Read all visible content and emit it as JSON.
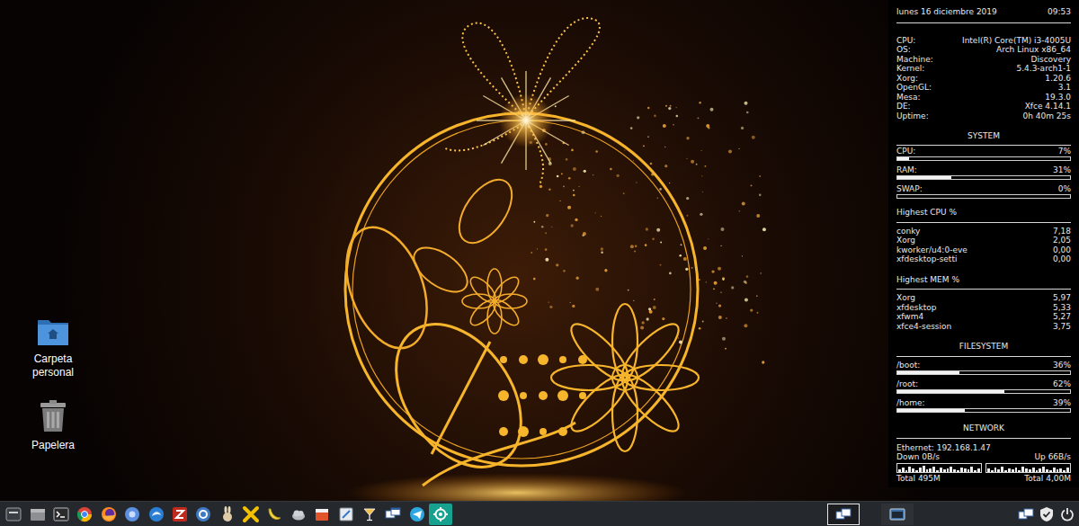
{
  "desktop": {
    "icons": [
      {
        "label": "Carpeta personal"
      },
      {
        "label": "Papelera"
      }
    ]
  },
  "conky": {
    "date": "lunes 16 diciembre 2019",
    "time": "09:53",
    "info": [
      {
        "key": "CPU:",
        "value": "Intel(R) Core(TM) i3-4005U"
      },
      {
        "key": "OS:",
        "value": "Arch Linux x86_64"
      },
      {
        "key": "Machine:",
        "value": "Discovery"
      },
      {
        "key": "Kernel:",
        "value": "5.4.3-arch1-1"
      },
      {
        "key": "Xorg:",
        "value": "1.20.6"
      },
      {
        "key": "OpenGL:",
        "value": "3.1"
      },
      {
        "key": "Mesa:",
        "value": "19.3.0"
      },
      {
        "key": "DE:",
        "value": "Xfce 4.14.1"
      },
      {
        "key": "Uptime:",
        "value": "0h 40m 25s"
      }
    ],
    "system": {
      "title": "SYSTEM",
      "meters": [
        {
          "label": "CPU:",
          "reading": "7%",
          "level": 0.07
        },
        {
          "label": "RAM:",
          "reading": "31%",
          "level": 0.31
        },
        {
          "label": "SWAP:",
          "reading": "0%",
          "level": 0
        }
      ]
    },
    "top_cpu": {
      "title": "Highest CPU %",
      "rows": [
        {
          "name": "conky",
          "value": "7,18"
        },
        {
          "name": "Xorg",
          "value": "2,05"
        },
        {
          "name": "kworker/u4:0-eve",
          "value": "0,00"
        },
        {
          "name": "xfdesktop-setti",
          "value": "0,00"
        }
      ]
    },
    "top_mem": {
      "title": "Highest MEM %",
      "rows": [
        {
          "name": "Xorg",
          "value": "5,97"
        },
        {
          "name": "xfdesktop",
          "value": "5,33"
        },
        {
          "name": "xfwm4",
          "value": "5,27"
        },
        {
          "name": "xfce4-session",
          "value": "3,75"
        }
      ]
    },
    "filesystem": {
      "title": "FILESYSTEM",
      "meters": [
        {
          "label": "/boot:",
          "reading": "36%",
          "level": 0.36
        },
        {
          "label": "/root:",
          "reading": "62%",
          "level": 0.62
        },
        {
          "label": "/home:",
          "reading": "39%",
          "level": 0.39
        }
      ]
    },
    "network": {
      "title": "NETWORK",
      "address": "Ethernet: 192.168.1.47",
      "down": "Down 0B/s",
      "up": "Up 66B/s",
      "down_graph": [
        0.3,
        0.5,
        0.2,
        0.6,
        0.4,
        0.2,
        0.5,
        0.7,
        0.3,
        0.4,
        0.6,
        0.2,
        0.5,
        0.3,
        0.4,
        0.6,
        0.3,
        0.2,
        0.5,
        0.4,
        0.3,
        0.6,
        0.2,
        0.4
      ],
      "up_graph": [
        0.4,
        0.2,
        0.5,
        0.3,
        0.6,
        0.2,
        0.4,
        0.3,
        0.5,
        0.2,
        0.6,
        0.4,
        0.3,
        0.5,
        0.2,
        0.4,
        0.6,
        0.3,
        0.2,
        0.5,
        0.3,
        0.4,
        0.2,
        0.5
      ],
      "total_down": "Total 495M",
      "total_up": "Total 4,00M"
    }
  },
  "taskbar": {
    "launchers": [
      {
        "selected": false
      },
      {
        "selected": false
      },
      {
        "selected": false
      },
      {
        "selected": false
      },
      {
        "selected": false
      },
      {
        "selected": false
      },
      {
        "selected": false
      },
      {
        "selected": false
      },
      {
        "selected": false
      },
      {
        "selected": false
      },
      {
        "selected": false
      },
      {
        "selected": false
      },
      {
        "selected": false
      },
      {
        "selected": false
      },
      {
        "selected": false
      },
      {
        "selected": false
      },
      {
        "selected": false
      },
      {
        "selected": false
      },
      {
        "selected": true
      }
    ],
    "windows": [
      {
        "selected": true
      },
      {
        "selected": false
      }
    ]
  }
}
